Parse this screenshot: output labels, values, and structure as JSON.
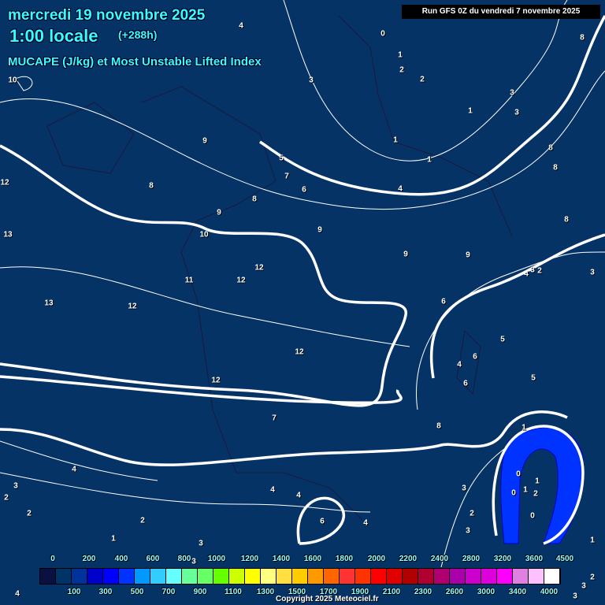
{
  "header": {
    "date": "mercredi 19 novembre 2025",
    "time": "1:00 locale",
    "offset": "(+288h)",
    "parameter": "MUCAPE (J/kg) et Most Unstable Lifted Index",
    "run": "Run GFS 0Z du vendredi 7 novembre 2025"
  },
  "colorbar": {
    "colors": [
      "#0a1040",
      "#003366",
      "#003399",
      "#0000cc",
      "#0000ff",
      "#0033ff",
      "#0099ff",
      "#33ccff",
      "#66ffff",
      "#66ff99",
      "#66ff66",
      "#66ff00",
      "#ccff00",
      "#ffff00",
      "#ffff80",
      "#ffe040",
      "#ffcc00",
      "#ff9900",
      "#ff6600",
      "#ff3333",
      "#ff3300",
      "#ff0000",
      "#e00000",
      "#b00000",
      "#b00030",
      "#b00070",
      "#aa00aa",
      "#cc00cc",
      "#dd00dd",
      "#ff00ff",
      "#e080e0",
      "#ffc0ff",
      "#ffffff"
    ],
    "top_labels": [
      "0",
      "200",
      "400",
      "600",
      "800",
      "1000",
      "1200",
      "1400",
      "1600",
      "1800",
      "2000",
      "2200",
      "2400",
      "2800",
      "3200",
      "3600",
      "4500"
    ],
    "bottom_labels": [
      "100",
      "300",
      "500",
      "700",
      "900",
      "1100",
      "1300",
      "1500",
      "1700",
      "1900",
      "2100",
      "2300",
      "2600",
      "3000",
      "3400",
      "4000"
    ]
  },
  "lifted_index_labels": [
    "10",
    "12",
    "13",
    "13",
    "12",
    "11",
    "12",
    "12",
    "9",
    "8",
    "8",
    "9",
    "10",
    "9",
    "9",
    "9",
    "12",
    "12",
    "7",
    "8",
    "6",
    "5",
    "5",
    "4",
    "6",
    "6",
    "4",
    "3",
    "2",
    "3",
    "8",
    "8",
    "8",
    "3",
    "1",
    "3",
    "2",
    "2",
    "1",
    "0",
    "8",
    "4",
    "3",
    "5",
    "7",
    "6",
    "4",
    "1",
    "1",
    "1",
    "0",
    "0",
    "1",
    "2",
    "1",
    "0",
    "3",
    "3",
    "2",
    "4",
    "6",
    "4",
    "4",
    "4",
    "3",
    "2",
    "2",
    "2",
    "1",
    "3",
    "3",
    "1",
    "4",
    "3",
    "2",
    "3"
  ],
  "copyright": "Copyright 2025 Meteociel.fr"
}
